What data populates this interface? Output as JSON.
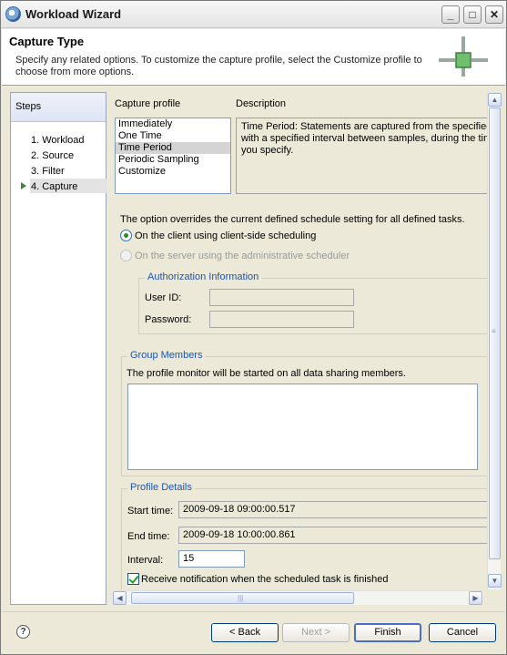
{
  "window": {
    "title": "Workload Wizard",
    "minimize": "_",
    "maximize": "□",
    "close": "✕"
  },
  "banner": {
    "title": "Capture Type",
    "description": "Specify any related options. To customize the capture profile, select the Customize profile to choose from more options."
  },
  "steps": {
    "header": "Steps",
    "items": [
      "1. Workload",
      "2. Source",
      "3. Filter",
      "4. Capture"
    ],
    "active_index": 3
  },
  "capture": {
    "profile_label": "Capture profile",
    "description_label": "Description",
    "profiles": [
      "Immediately",
      "One Time",
      "Time Period",
      "Periodic Sampling",
      "Customize"
    ],
    "selected_profile": "Time Period",
    "description_lines": [
      "Time Period: Statements are captured from the specified",
      "with a specified interval between samples, during the tim",
      "you specify."
    ]
  },
  "schedule": {
    "override_note": "The option overrides the current defined schedule setting for all defined tasks.",
    "option_client": "On the client using client-side scheduling",
    "option_server": "On the server using the administrative scheduler",
    "selected": "client"
  },
  "authorization": {
    "title": "Authorization Information",
    "user_id_label": "User ID:",
    "user_id_value": "",
    "password_label": "Password:",
    "password_value": ""
  },
  "group_members": {
    "title": "Group Members",
    "note": "The profile monitor will be started on all data sharing members."
  },
  "profile_details": {
    "title": "Profile Details",
    "start_label": "Start time:",
    "start_value": "2009-09-18 09:00:00.517",
    "end_label": "End time:",
    "end_value": "2009-09-18 10:00:00.861",
    "interval_label": "Interval:",
    "interval_value": "15",
    "notify_label": "Receive notification when the scheduled task is finished",
    "notify_checked": true
  },
  "scrollbars": {
    "up": "▲",
    "down": "▼",
    "left": "◀",
    "right": "▶",
    "grip_h": "|||",
    "grip_v": "≡"
  },
  "footer": {
    "help": "?",
    "back": "< Back",
    "next": "Next >",
    "finish": "Finish",
    "cancel": "Cancel"
  }
}
